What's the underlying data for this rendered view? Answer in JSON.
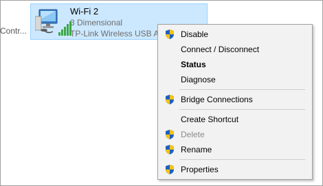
{
  "background_item": {
    "label": "Contr..."
  },
  "adapter": {
    "name": "Wi-Fi 2",
    "status": "3 Dimensional",
    "device": "TP-Link Wireless USB Ad",
    "icon": "wifi-adapter-icon"
  },
  "context_menu": {
    "items": [
      {
        "label": "Disable",
        "shield": true,
        "bold": false,
        "disabled": false
      },
      {
        "label": "Connect / Disconnect",
        "shield": false,
        "bold": false,
        "disabled": false
      },
      {
        "label": "Status",
        "shield": false,
        "bold": true,
        "disabled": false
      },
      {
        "label": "Diagnose",
        "shield": false,
        "bold": false,
        "disabled": false
      },
      {
        "label": "Bridge Connections",
        "shield": true,
        "bold": false,
        "disabled": false
      },
      {
        "label": "Create Shortcut",
        "shield": false,
        "bold": false,
        "disabled": false
      },
      {
        "label": "Delete",
        "shield": true,
        "bold": false,
        "disabled": true
      },
      {
        "label": "Rename",
        "shield": true,
        "bold": false,
        "disabled": false
      },
      {
        "label": "Properties",
        "shield": true,
        "bold": false,
        "disabled": false
      }
    ]
  },
  "colors": {
    "selection_bg": "#cce8ff",
    "selection_border": "#99d1ff",
    "menu_bg": "#f2f2f2",
    "disabled_text": "#8a8a8a"
  }
}
